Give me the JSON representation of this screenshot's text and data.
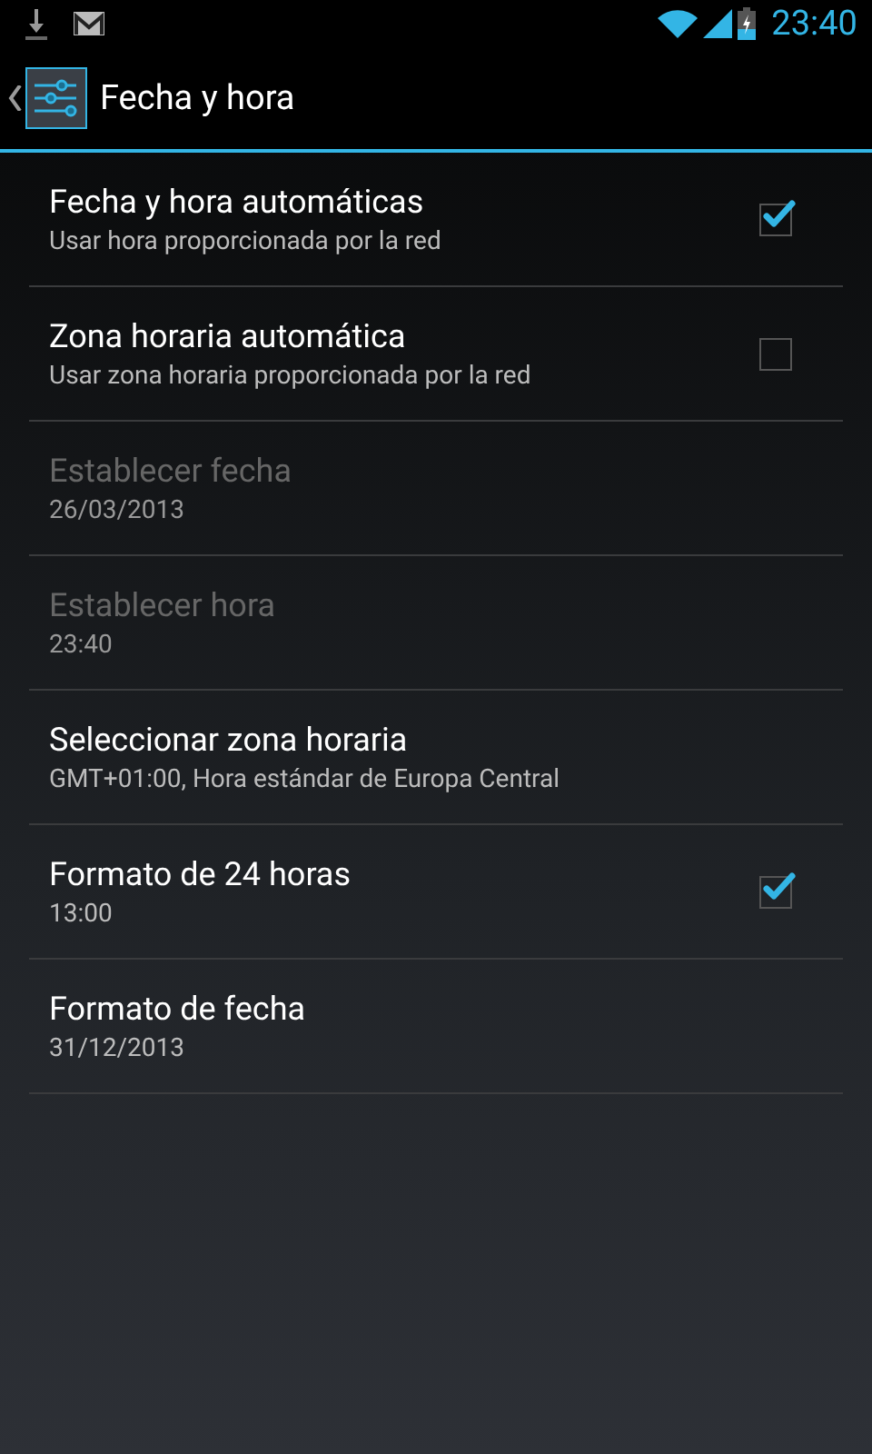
{
  "status_bar": {
    "time": "23:40"
  },
  "action_bar": {
    "title": "Fecha y hora"
  },
  "preferences": [
    {
      "kind": "checkbox",
      "title": "Fecha y hora automáticas",
      "summary": "Usar hora proporcionada por la red",
      "checked": true,
      "disabled": false
    },
    {
      "kind": "checkbox",
      "title": "Zona horaria automática",
      "summary": "Usar zona horaria proporcionada por la red",
      "checked": false,
      "disabled": false
    },
    {
      "kind": "plain",
      "title": "Establecer fecha",
      "summary": "26/03/2013",
      "disabled": true
    },
    {
      "kind": "plain",
      "title": "Establecer hora",
      "summary": "23:40",
      "disabled": true
    },
    {
      "kind": "plain",
      "title": "Seleccionar zona horaria",
      "summary": "GMT+01:00, Hora estándar de Europa Central",
      "disabled": false
    },
    {
      "kind": "checkbox",
      "title": "Formato de 24 horas",
      "summary": "13:00",
      "checked": true,
      "disabled": false
    },
    {
      "kind": "plain",
      "title": "Formato de fecha",
      "summary": "31/12/2013",
      "disabled": false
    }
  ]
}
